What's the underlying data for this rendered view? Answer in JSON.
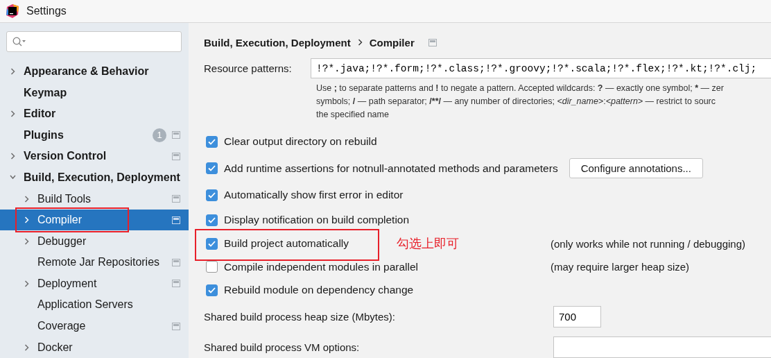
{
  "window": {
    "title": "Settings"
  },
  "sidebar": {
    "items": [
      {
        "label": "Appearance & Behavior",
        "expandable": true,
        "expanded": false,
        "selected": false,
        "annotated": false,
        "project_icon": false
      },
      {
        "label": "Keymap",
        "expandable": false,
        "selected": false,
        "annotated": false,
        "project_icon": false
      },
      {
        "label": "Editor",
        "expandable": true,
        "expanded": false,
        "selected": false,
        "annotated": false,
        "project_icon": false
      },
      {
        "label": "Plugins",
        "expandable": false,
        "selected": false,
        "annotated": false,
        "project_icon": true,
        "badge": "1"
      },
      {
        "label": "Version Control",
        "expandable": true,
        "expanded": false,
        "selected": false,
        "annotated": false,
        "project_icon": true
      },
      {
        "label": "Build, Execution, Deployment",
        "expandable": true,
        "expanded": true,
        "selected": false,
        "annotated": false,
        "project_icon": false,
        "children": [
          {
            "label": "Build Tools",
            "expandable": true,
            "expanded": false,
            "selected": false,
            "annotated": false,
            "project_icon": true
          },
          {
            "label": "Compiler",
            "expandable": true,
            "expanded": false,
            "selected": true,
            "annotated": true,
            "project_icon": true
          },
          {
            "label": "Debugger",
            "expandable": true,
            "expanded": false,
            "selected": false,
            "annotated": false,
            "project_icon": false
          },
          {
            "label": "Remote Jar Repositories",
            "expandable": false,
            "selected": false,
            "annotated": false,
            "project_icon": true
          },
          {
            "label": "Deployment",
            "expandable": true,
            "expanded": false,
            "selected": false,
            "annotated": false,
            "project_icon": true
          },
          {
            "label": "Application Servers",
            "expandable": false,
            "selected": false,
            "annotated": false,
            "project_icon": false
          },
          {
            "label": "Coverage",
            "expandable": false,
            "selected": false,
            "annotated": false,
            "project_icon": true
          },
          {
            "label": "Docker",
            "expandable": true,
            "expanded": false,
            "selected": false,
            "annotated": false,
            "project_icon": false
          }
        ]
      }
    ]
  },
  "breadcrumb": [
    "Build, Execution, Deployment",
    "Compiler"
  ],
  "resource_patterns": {
    "label": "Resource patterns:",
    "value": "!?*.java;!?*.form;!?*.class;!?*.groovy;!?*.scala;!?*.flex;!?*.kt;!?*.clj;",
    "help": [
      [
        {
          "text": "Use ",
          "kind": "plain"
        },
        {
          "text": ";",
          "kind": "symbol"
        },
        {
          "text": " to separate patterns and ",
          "kind": "plain"
        },
        {
          "text": "!",
          "kind": "symbol"
        },
        {
          "text": " to negate a pattern. Accepted wildcards: ",
          "kind": "plain"
        },
        {
          "text": "?",
          "kind": "symbol"
        },
        {
          "text": " — exactly one symbol; ",
          "kind": "plain"
        },
        {
          "text": "*",
          "kind": "symbol"
        },
        {
          "text": " — zer",
          "kind": "plain"
        }
      ],
      [
        {
          "text": "symbols; ",
          "kind": "plain"
        },
        {
          "text": "/",
          "kind": "symbol"
        },
        {
          "text": " — path separator; ",
          "kind": "plain"
        },
        {
          "text": "/**/",
          "kind": "symbol"
        },
        {
          "text": " — any number of directories; ",
          "kind": "plain"
        },
        {
          "text": "<dir_name>",
          "kind": "variable"
        },
        {
          "text": ":",
          "kind": "plain"
        },
        {
          "text": "<pattern>",
          "kind": "variable"
        },
        {
          "text": " — restrict to sourc",
          "kind": "plain"
        }
      ],
      [
        {
          "text": "the specified name",
          "kind": "plain"
        }
      ]
    ]
  },
  "options": [
    {
      "label": "Clear output directory on rebuild",
      "checked": true,
      "annotated": false
    },
    {
      "label": "Add runtime assertions for notnull-annotated methods and parameters",
      "checked": true,
      "annotated": false,
      "button": "Configure annotations..."
    },
    {
      "label": "Automatically show first error in editor",
      "checked": true,
      "annotated": false
    },
    {
      "label": "Display notification on build completion",
      "checked": true,
      "annotated": false
    },
    {
      "label": "Build project automatically",
      "checked": true,
      "annotated": true,
      "callout": "勾选上即可",
      "note": "(only works while not running / debugging)"
    },
    {
      "label": "Compile independent modules in parallel",
      "checked": false,
      "annotated": false,
      "note": "(may require larger heap size)"
    },
    {
      "label": "Rebuild module on dependency change",
      "checked": true,
      "annotated": false
    }
  ],
  "heap_size": {
    "label": "Shared build process heap size (Mbytes):",
    "value": "700"
  },
  "vm_options": {
    "label": "Shared build process VM options:"
  }
}
